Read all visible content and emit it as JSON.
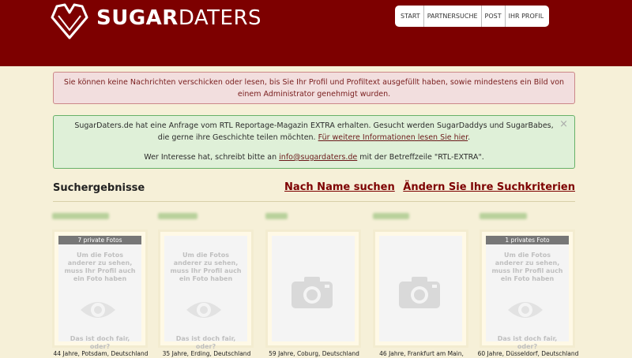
{
  "header": {
    "logo_part1": "SUGAR",
    "logo_part2": "DATERS",
    "nav": [
      "START",
      "PARTNERSUCHE",
      "POST",
      "IHR PROFIL"
    ]
  },
  "alerts": {
    "profile_warning": "Sie können keine Nachrichten verschicken oder lesen, bis Sie Ihr Profil und Profiltext ausgefüllt haben, sowie mindestens ein Bild von einem Administrator genehmigt wurden.",
    "rtl_line1": "SugarDaters.de hat eine Anfrage vom RTL Reportage-Magazin EXTRA erhalten. Gesucht werden SugarDaddys und SugarBabes, die gerne ihre Geschichte teilen möchten.",
    "rtl_link": "Für weitere Informationen lesen Sie hier",
    "rtl_line2_pre": "Wer Interesse hat, schreibt bitte an",
    "rtl_email": "info@sugardaters.de",
    "rtl_line2_post": "mit der Betreffzeile \"RTL-EXTRA\".",
    "close": "×"
  },
  "results": {
    "title": "Suchergebnisse",
    "search_by_name": "Nach Name suchen",
    "change_criteria": "Ändern Sie Ihre Suchkriterien"
  },
  "cards": [
    {
      "badge": "7 private Fotos",
      "locked": true,
      "location": "44 Jahre, Potsdam, Deutschland"
    },
    {
      "badge": "",
      "locked": true,
      "location": "35 Jahre, Erding, Deutschland"
    },
    {
      "badge": "",
      "locked": false,
      "location": "59 Jahre, Coburg, Deutschland"
    },
    {
      "badge": "",
      "locked": false,
      "location": "46 Jahre, Frankfurt am Main,"
    },
    {
      "badge": "1 privates Foto",
      "locked": true,
      "location": "60 Jahre, Düsseldorf, Deutschland"
    }
  ],
  "locked_text": {
    "top": "Um die Fotos anderer zu sehen, muss Ihr Profil auch ein Foto haben",
    "bottom": "Das ist doch fair, oder?"
  },
  "colors": {
    "header": "#7d0000",
    "background": "#f6f0d8",
    "alert_red": "#f2dede",
    "alert_green": "#dff0d8"
  }
}
